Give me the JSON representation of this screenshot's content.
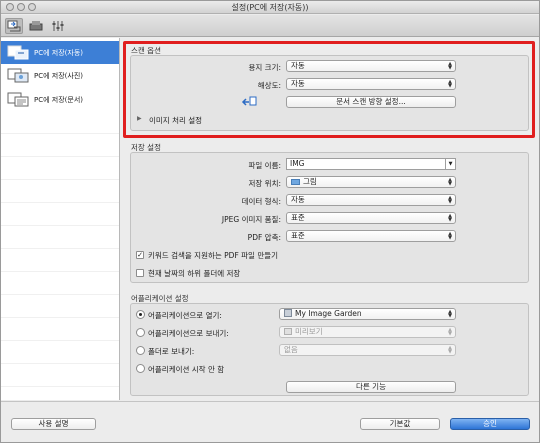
{
  "window": {
    "title": "설정(PC에 저장(자동))"
  },
  "toolbar": {
    "icons": [
      "scan-from-computer-icon",
      "scan-from-panel-icon",
      "general-settings-icon"
    ]
  },
  "sidebar": {
    "items": [
      {
        "label": "PC에 저장(자동)",
        "selected": true
      },
      {
        "label": "PC에 저장(사진)",
        "selected": false
      },
      {
        "label": "PC에 저장(문서)",
        "selected": false
      }
    ]
  },
  "scan_options": {
    "title": "스캔 옵션",
    "paper_size_label": "용지 크기:",
    "paper_size_value": "자동",
    "resolution_label": "해상도:",
    "resolution_value": "자동",
    "orientation_button": "문서 스캔 방향 설정...",
    "image_processing_label": "이미지 처리 설정"
  },
  "save_settings": {
    "title": "저장 설정",
    "filename_label": "파일 이름:",
    "filename_value": "IMG",
    "location_label": "저장 위치:",
    "location_value": "그림",
    "format_label": "데이터 형식:",
    "format_value": "자동",
    "jpeg_label": "JPEG 이미지 품질:",
    "jpeg_value": "표준",
    "pdf_label": "PDF 압축:",
    "pdf_value": "표준",
    "keyword_pdf_label": "키워드 검색을 지원하는 PDF 파일 만들기",
    "keyword_pdf_checked": true,
    "date_subfolder_label": "현재 날짜의 하위 폴더에 저장",
    "date_subfolder_checked": false
  },
  "app_settings": {
    "title": "어플리케이션 설정",
    "open_with_label": "어플리케이션으로 열기:",
    "open_with_value": "My Image Garden",
    "send_to_app_label": "어플리케이션으로 보내기:",
    "send_to_app_value": "미리보기",
    "send_to_folder_label": "폴더로 보내기:",
    "send_to_folder_value": "없음",
    "no_app_label": "어플리케이션 시작 안 함",
    "more_functions_button": "다른 기능"
  },
  "footer": {
    "instructions_button": "사용 설명",
    "defaults_button": "기본값",
    "ok_button": "승인"
  }
}
